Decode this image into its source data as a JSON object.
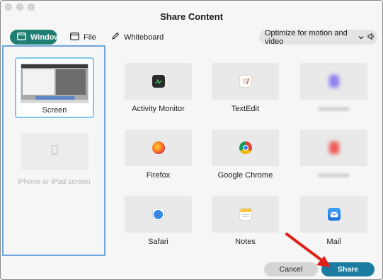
{
  "window": {
    "title": "Share Content"
  },
  "tabs": [
    {
      "label": "Window",
      "active": true,
      "icon": "window-icon"
    },
    {
      "label": "File",
      "active": false,
      "icon": "file-icon"
    },
    {
      "label": "Whiteboard",
      "active": false,
      "icon": "pen-icon"
    }
  ],
  "optimize": {
    "label": "Optimize for motion and video",
    "icon": "chevron-down-icon",
    "audio_icon": "speaker-icon"
  },
  "sources": {
    "screen_label": "Screen",
    "iphone_label": "iPhone or iPad screen"
  },
  "apps": [
    {
      "label": "Activity Monitor",
      "icon": "activity-monitor-icon"
    },
    {
      "label": "TextEdit",
      "icon": "textedit-icon"
    },
    {
      "label": "",
      "icon": "blurred-app-icon",
      "blurred": true
    },
    {
      "label": "Firefox",
      "icon": "firefox-icon"
    },
    {
      "label": "Google Chrome",
      "icon": "chrome-icon"
    },
    {
      "label": "",
      "icon": "blurred-app-icon",
      "blurred": true
    },
    {
      "label": "Safari",
      "icon": "safari-icon"
    },
    {
      "label": "Notes",
      "icon": "notes-icon"
    },
    {
      "label": "Mail",
      "icon": "mail-icon"
    }
  ],
  "buttons": {
    "cancel": "Cancel",
    "share": "Share"
  },
  "colors": {
    "accent": "#1e7f72",
    "share_button": "#1c7ba0",
    "selection_border": "#6ea6df",
    "annotation_arrow": "#e0201a"
  }
}
